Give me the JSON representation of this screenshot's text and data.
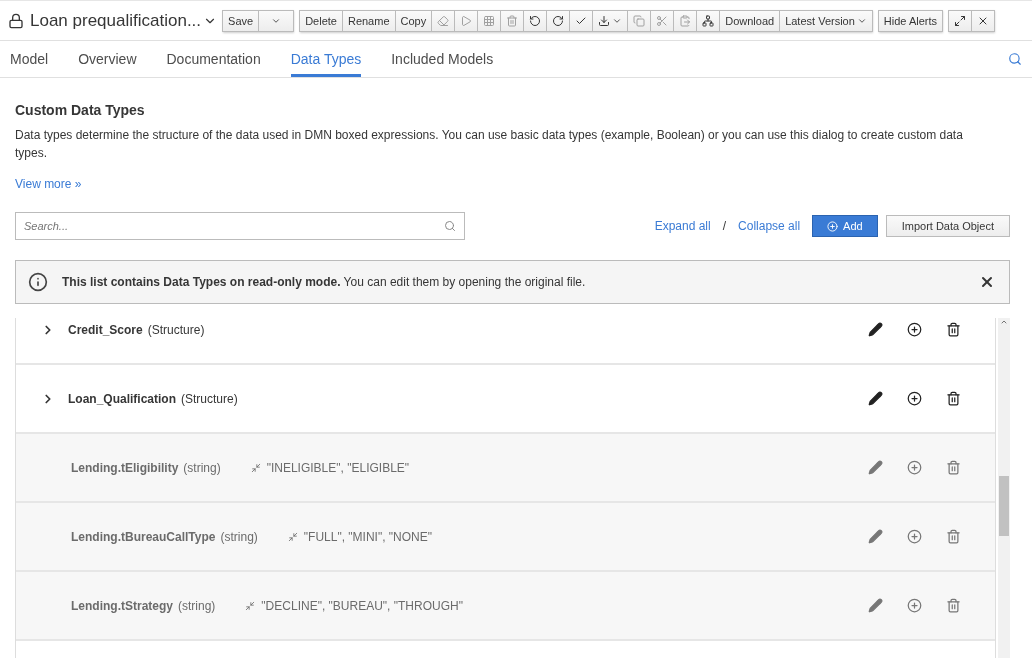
{
  "title": "Loan prequalification...",
  "toolbar": [
    {
      "items": [
        {
          "kind": "text",
          "label": "Save"
        },
        {
          "kind": "caret"
        }
      ]
    },
    {
      "items": [
        {
          "kind": "text",
          "label": "Delete"
        },
        {
          "kind": "text",
          "label": "Rename"
        },
        {
          "kind": "text",
          "label": "Copy"
        },
        {
          "kind": "icon",
          "disabled": true
        },
        {
          "kind": "icon",
          "disabled": true
        },
        {
          "kind": "icon",
          "disabled": true
        },
        {
          "kind": "icon",
          "disabled": true
        },
        {
          "kind": "icon",
          "disabled": false
        },
        {
          "kind": "icon",
          "disabled": false
        },
        {
          "kind": "icon",
          "disabled": false
        },
        {
          "kind": "icon-caret",
          "disabled": false
        },
        {
          "kind": "icon",
          "disabled": true
        },
        {
          "kind": "icon",
          "disabled": true
        },
        {
          "kind": "icon",
          "disabled": true
        },
        {
          "kind": "icon",
          "disabled": false
        },
        {
          "kind": "text",
          "label": "Download"
        },
        {
          "kind": "text-caret",
          "label": "Latest Version"
        }
      ]
    },
    {
      "items": [
        {
          "kind": "text",
          "label": "Hide Alerts"
        }
      ]
    },
    {
      "items": [
        {
          "kind": "icon",
          "disabled": false
        },
        {
          "kind": "icon",
          "disabled": false
        }
      ]
    }
  ],
  "tabs": [
    {
      "label": "Model",
      "selected": false
    },
    {
      "label": "Overview",
      "selected": false
    },
    {
      "label": "Documentation",
      "selected": false
    },
    {
      "label": "Data Types",
      "selected": true
    },
    {
      "label": "Included Models",
      "selected": false
    }
  ],
  "heading": "Custom Data Types",
  "description": "Data types determine the structure of the data used in DMN boxed expressions. You can use basic data types (example, Boolean) or you can use this dialog to create custom data types.",
  "view_more": "View more »",
  "search": {
    "placeholder": "Search..."
  },
  "expand_all": "Expand all",
  "separator": "/",
  "collapse_all": "Collapse all",
  "add_button": "Add",
  "import_button": "Import Data Object",
  "alert": "**This list contains Data Types on read-only mode.** You can edit them by opening the original file.",
  "rows": [
    {
      "kind": "structure",
      "name": "Credit_Score",
      "type": "(Structure)",
      "expanded": false,
      "disabled": false
    },
    {
      "kind": "structure",
      "name": "Loan_Qualification",
      "type": "(Structure)",
      "expanded": false,
      "disabled": false
    },
    {
      "kind": "constrained",
      "name": "Lending.tEligibility",
      "type": "(string)",
      "constraint": "\"INELIGIBLE\", \"ELIGIBLE\"",
      "disabled": true
    },
    {
      "kind": "constrained",
      "name": "Lending.tBureauCallType",
      "type": "(string)",
      "constraint": "\"FULL\", \"MINI\", \"NONE\"",
      "disabled": true
    },
    {
      "kind": "constrained",
      "name": "Lending.tStrategy",
      "type": "(string)",
      "constraint": "\"DECLINE\", \"BUREAU\", \"THROUGH\"",
      "disabled": true
    }
  ]
}
